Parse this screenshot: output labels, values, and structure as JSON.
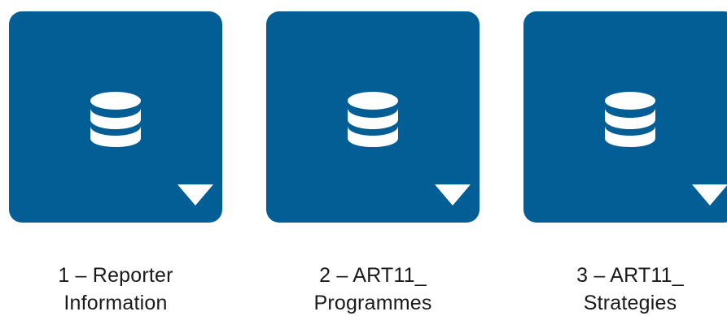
{
  "tiles": [
    {
      "line1": "1 – Reporter",
      "line2": "Information",
      "icon": "database-icon",
      "menu_icon": "caret-down-icon",
      "color": "#045e96"
    },
    {
      "line1": "2 – ART11_",
      "line2": "Programmes",
      "icon": "database-icon",
      "menu_icon": "caret-down-icon",
      "color": "#045e96"
    },
    {
      "line1": "3 – ART11_",
      "line2": "Strategies",
      "icon": "database-icon",
      "menu_icon": "caret-down-icon",
      "color": "#045e96"
    }
  ]
}
